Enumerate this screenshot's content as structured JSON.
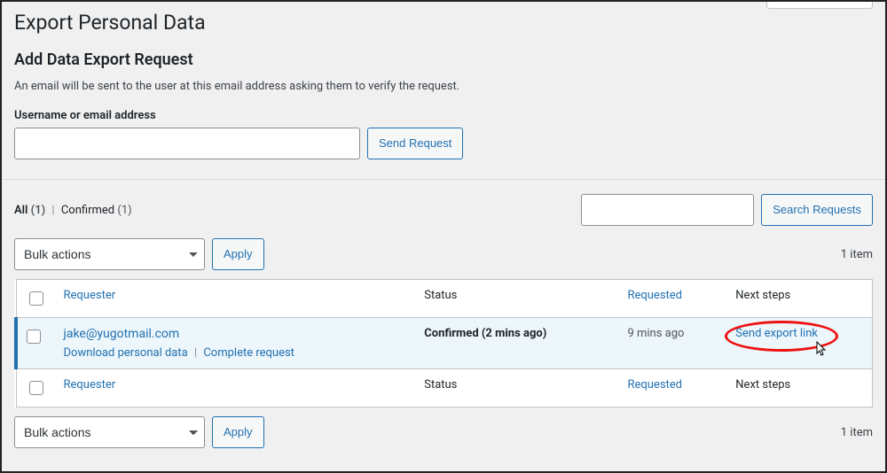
{
  "page": {
    "title": "Export Personal Data",
    "subtitle": "Add Data Export Request",
    "description": "An email will be sent to the user at this email address asking them to verify the request.",
    "username_label": "Username or email address",
    "send_request_label": "Send Request"
  },
  "filters": {
    "all_label": "All",
    "all_count": "(1)",
    "confirmed_label": "Confirmed",
    "confirmed_count": "(1)"
  },
  "search": {
    "button_label": "Search Requests"
  },
  "bulk": {
    "placeholder": "Bulk actions",
    "apply_label": "Apply",
    "item_count": "1 item"
  },
  "columns": {
    "requester": "Requester",
    "status": "Status",
    "requested": "Requested",
    "next_steps": "Next steps"
  },
  "row": {
    "email": "jake@yugotmail.com",
    "download_label": "Download personal data",
    "complete_label": "Complete request",
    "status": "Confirmed (2 mins ago)",
    "requested": "9 mins ago",
    "next_link": "Send export link"
  }
}
